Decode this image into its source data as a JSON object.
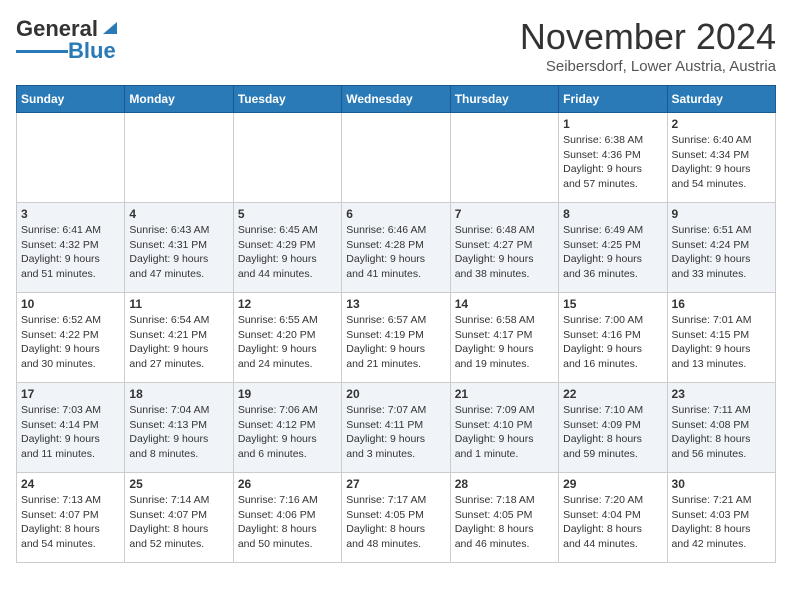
{
  "header": {
    "logo_general": "General",
    "logo_blue": "Blue",
    "month_title": "November 2024",
    "location": "Seibersdorf, Lower Austria, Austria"
  },
  "weekdays": [
    "Sunday",
    "Monday",
    "Tuesday",
    "Wednesday",
    "Thursday",
    "Friday",
    "Saturday"
  ],
  "weeks": [
    [
      {
        "day": "",
        "info": ""
      },
      {
        "day": "",
        "info": ""
      },
      {
        "day": "",
        "info": ""
      },
      {
        "day": "",
        "info": ""
      },
      {
        "day": "",
        "info": ""
      },
      {
        "day": "1",
        "info": "Sunrise: 6:38 AM\nSunset: 4:36 PM\nDaylight: 9 hours\nand 57 minutes."
      },
      {
        "day": "2",
        "info": "Sunrise: 6:40 AM\nSunset: 4:34 PM\nDaylight: 9 hours\nand 54 minutes."
      }
    ],
    [
      {
        "day": "3",
        "info": "Sunrise: 6:41 AM\nSunset: 4:32 PM\nDaylight: 9 hours\nand 51 minutes."
      },
      {
        "day": "4",
        "info": "Sunrise: 6:43 AM\nSunset: 4:31 PM\nDaylight: 9 hours\nand 47 minutes."
      },
      {
        "day": "5",
        "info": "Sunrise: 6:45 AM\nSunset: 4:29 PM\nDaylight: 9 hours\nand 44 minutes."
      },
      {
        "day": "6",
        "info": "Sunrise: 6:46 AM\nSunset: 4:28 PM\nDaylight: 9 hours\nand 41 minutes."
      },
      {
        "day": "7",
        "info": "Sunrise: 6:48 AM\nSunset: 4:27 PM\nDaylight: 9 hours\nand 38 minutes."
      },
      {
        "day": "8",
        "info": "Sunrise: 6:49 AM\nSunset: 4:25 PM\nDaylight: 9 hours\nand 36 minutes."
      },
      {
        "day": "9",
        "info": "Sunrise: 6:51 AM\nSunset: 4:24 PM\nDaylight: 9 hours\nand 33 minutes."
      }
    ],
    [
      {
        "day": "10",
        "info": "Sunrise: 6:52 AM\nSunset: 4:22 PM\nDaylight: 9 hours\nand 30 minutes."
      },
      {
        "day": "11",
        "info": "Sunrise: 6:54 AM\nSunset: 4:21 PM\nDaylight: 9 hours\nand 27 minutes."
      },
      {
        "day": "12",
        "info": "Sunrise: 6:55 AM\nSunset: 4:20 PM\nDaylight: 9 hours\nand 24 minutes."
      },
      {
        "day": "13",
        "info": "Sunrise: 6:57 AM\nSunset: 4:19 PM\nDaylight: 9 hours\nand 21 minutes."
      },
      {
        "day": "14",
        "info": "Sunrise: 6:58 AM\nSunset: 4:17 PM\nDaylight: 9 hours\nand 19 minutes."
      },
      {
        "day": "15",
        "info": "Sunrise: 7:00 AM\nSunset: 4:16 PM\nDaylight: 9 hours\nand 16 minutes."
      },
      {
        "day": "16",
        "info": "Sunrise: 7:01 AM\nSunset: 4:15 PM\nDaylight: 9 hours\nand 13 minutes."
      }
    ],
    [
      {
        "day": "17",
        "info": "Sunrise: 7:03 AM\nSunset: 4:14 PM\nDaylight: 9 hours\nand 11 minutes."
      },
      {
        "day": "18",
        "info": "Sunrise: 7:04 AM\nSunset: 4:13 PM\nDaylight: 9 hours\nand 8 minutes."
      },
      {
        "day": "19",
        "info": "Sunrise: 7:06 AM\nSunset: 4:12 PM\nDaylight: 9 hours\nand 6 minutes."
      },
      {
        "day": "20",
        "info": "Sunrise: 7:07 AM\nSunset: 4:11 PM\nDaylight: 9 hours\nand 3 minutes."
      },
      {
        "day": "21",
        "info": "Sunrise: 7:09 AM\nSunset: 4:10 PM\nDaylight: 9 hours\nand 1 minute."
      },
      {
        "day": "22",
        "info": "Sunrise: 7:10 AM\nSunset: 4:09 PM\nDaylight: 8 hours\nand 59 minutes."
      },
      {
        "day": "23",
        "info": "Sunrise: 7:11 AM\nSunset: 4:08 PM\nDaylight: 8 hours\nand 56 minutes."
      }
    ],
    [
      {
        "day": "24",
        "info": "Sunrise: 7:13 AM\nSunset: 4:07 PM\nDaylight: 8 hours\nand 54 minutes."
      },
      {
        "day": "25",
        "info": "Sunrise: 7:14 AM\nSunset: 4:07 PM\nDaylight: 8 hours\nand 52 minutes."
      },
      {
        "day": "26",
        "info": "Sunrise: 7:16 AM\nSunset: 4:06 PM\nDaylight: 8 hours\nand 50 minutes."
      },
      {
        "day": "27",
        "info": "Sunrise: 7:17 AM\nSunset: 4:05 PM\nDaylight: 8 hours\nand 48 minutes."
      },
      {
        "day": "28",
        "info": "Sunrise: 7:18 AM\nSunset: 4:05 PM\nDaylight: 8 hours\nand 46 minutes."
      },
      {
        "day": "29",
        "info": "Sunrise: 7:20 AM\nSunset: 4:04 PM\nDaylight: 8 hours\nand 44 minutes."
      },
      {
        "day": "30",
        "info": "Sunrise: 7:21 AM\nSunset: 4:03 PM\nDaylight: 8 hours\nand 42 minutes."
      }
    ]
  ]
}
